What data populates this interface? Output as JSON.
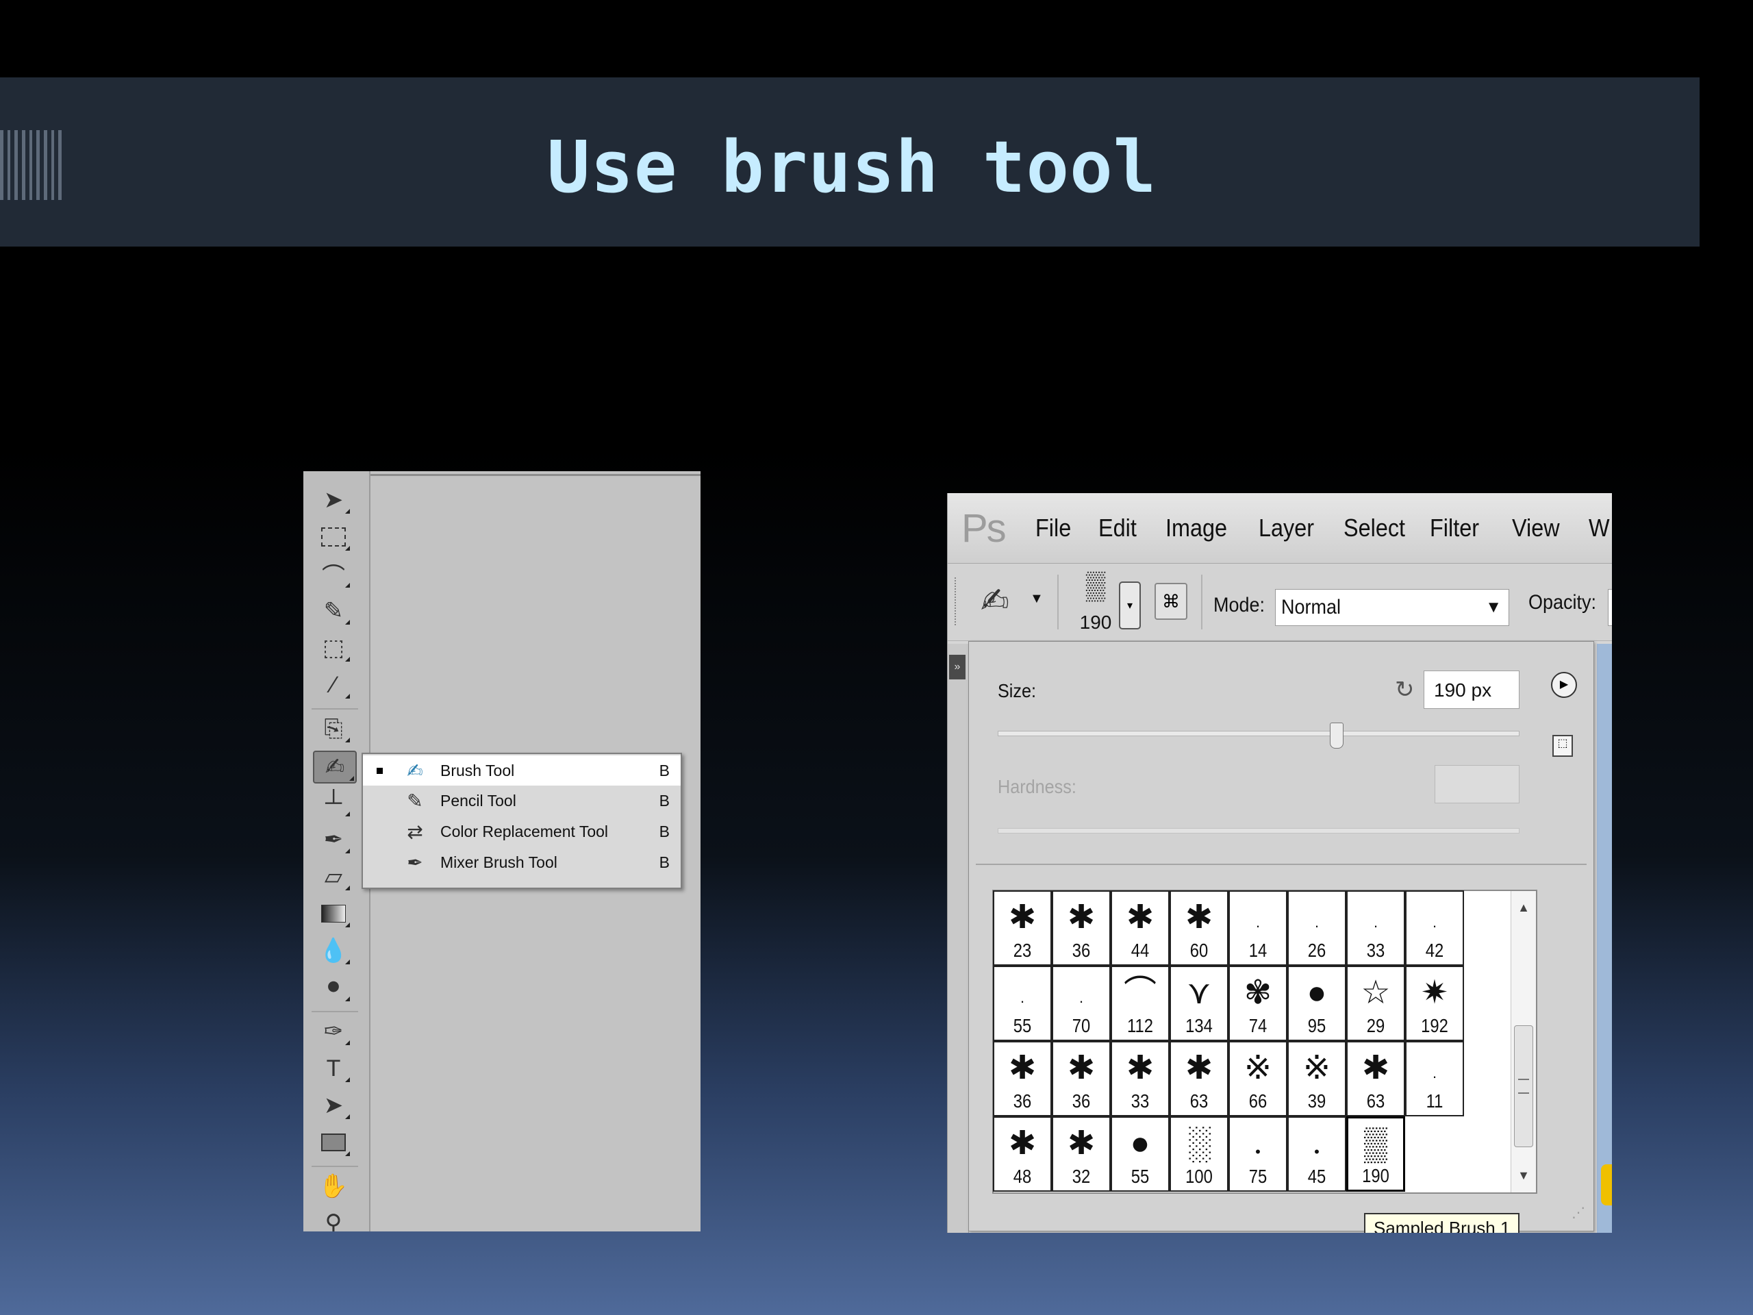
{
  "slide": {
    "title": "Use brush tool"
  },
  "toolbox": {
    "tools": [
      "move-tool",
      "marquee-tool",
      "lasso-tool",
      "quick-selection-tool",
      "crop-tool",
      "eyedropper-tool",
      "healing-brush-tool",
      "brush-tool",
      "clone-stamp-tool",
      "history-brush-tool",
      "eraser-tool",
      "gradient-tool",
      "blur-tool",
      "dodge-tool",
      "pen-tool",
      "type-tool",
      "path-selection-tool",
      "rectangle-tool",
      "hand-tool",
      "zoom-tool"
    ],
    "flyout": [
      {
        "label": "Brush Tool",
        "key": "B",
        "selected": true
      },
      {
        "label": "Pencil Tool",
        "key": "B",
        "selected": false
      },
      {
        "label": "Color Replacement Tool",
        "key": "B",
        "selected": false
      },
      {
        "label": "Mixer Brush Tool",
        "key": "B",
        "selected": false
      }
    ]
  },
  "photoshop": {
    "logo": "Ps",
    "menu": [
      "File",
      "Edit",
      "Image",
      "Layer",
      "Select",
      "Filter",
      "View",
      "W"
    ],
    "options": {
      "brush_size_num": "190",
      "mode_label": "Mode:",
      "mode_value": "Normal",
      "opacity_label": "Opacity:"
    },
    "picker": {
      "size_label": "Size:",
      "size_value": "190 px",
      "size_slider_fraction": 0.65,
      "hardness_label": "Hardness:",
      "brushes": [
        [
          "23",
          "36",
          "44",
          "60",
          "14",
          "26",
          "33",
          "42"
        ],
        [
          "55",
          "70",
          "112",
          "134",
          "74",
          "95",
          "29",
          "192"
        ],
        [
          "36",
          "36",
          "33",
          "63",
          "66",
          "39",
          "63",
          "11"
        ],
        [
          "48",
          "32",
          "55",
          "100",
          "75",
          "45",
          "190"
        ]
      ],
      "selected_brush": "190",
      "tooltip": "Sampled Brush 1"
    }
  }
}
